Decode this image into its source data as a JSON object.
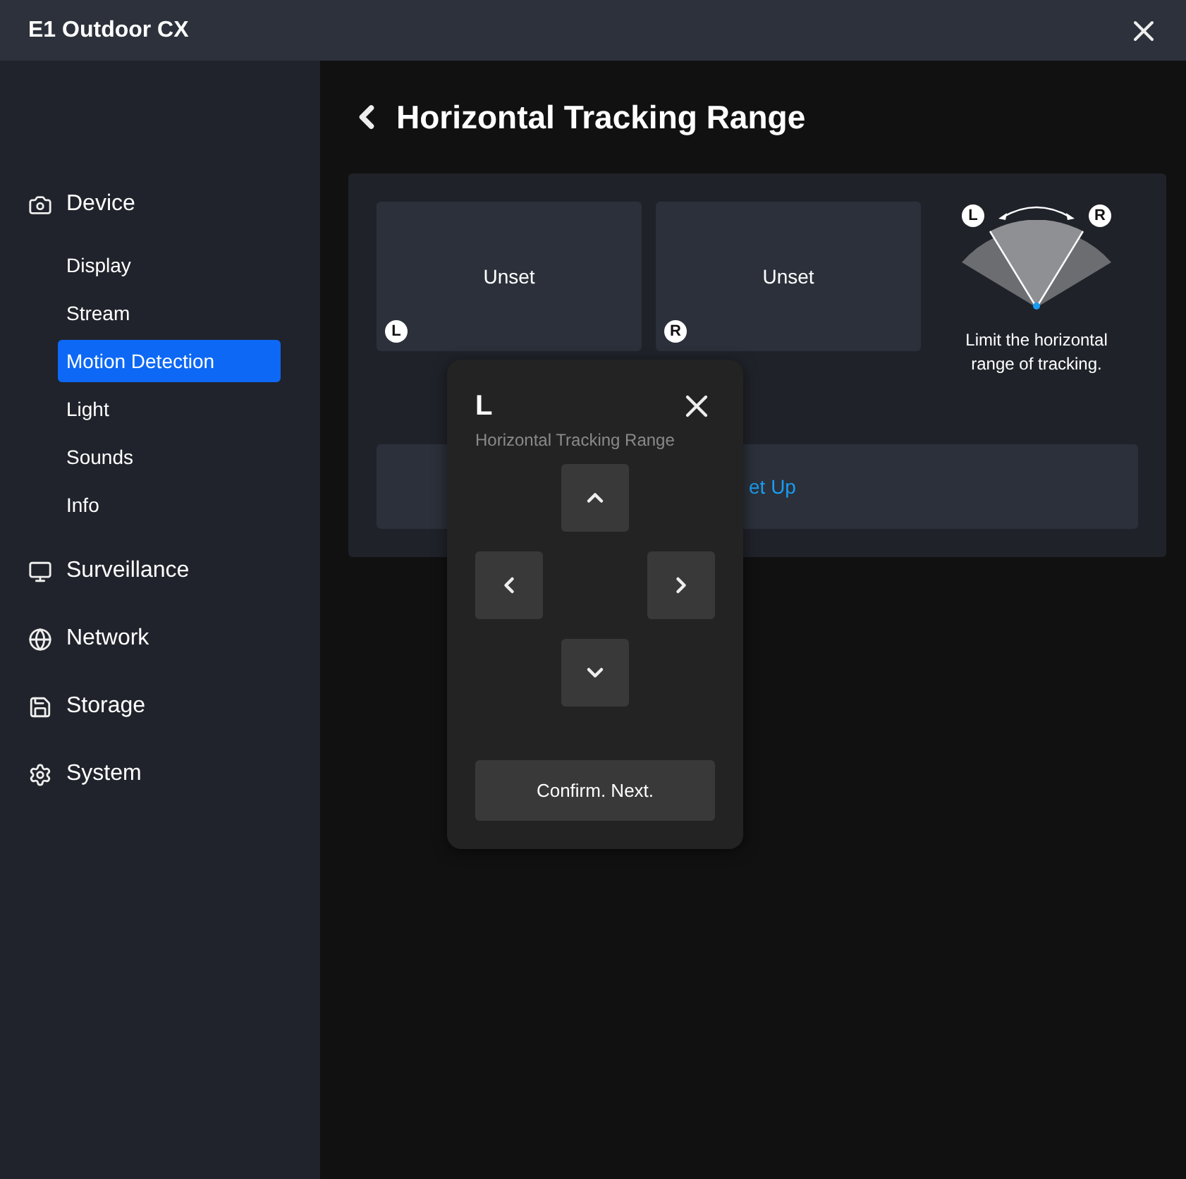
{
  "window": {
    "title": "E1 Outdoor CX"
  },
  "sidebar": {
    "groups": [
      {
        "label": "Device",
        "children": [
          {
            "label": "Display",
            "selected": false
          },
          {
            "label": "Stream",
            "selected": false
          },
          {
            "label": "Motion Detection",
            "selected": true
          },
          {
            "label": "Light",
            "selected": false
          },
          {
            "label": "Sounds",
            "selected": false
          },
          {
            "label": "Info",
            "selected": false
          }
        ]
      },
      {
        "label": "Surveillance"
      },
      {
        "label": "Network"
      },
      {
        "label": "Storage"
      },
      {
        "label": "System"
      }
    ]
  },
  "page": {
    "title": "Horizontal Tracking Range"
  },
  "tiles": [
    {
      "label": "Unset",
      "marker": "L"
    },
    {
      "label": "Unset",
      "marker": "R"
    }
  ],
  "diagram": {
    "left": "L",
    "right": "R",
    "caption": "Limit the horizontal range of tracking."
  },
  "setup_button": "et Up",
  "popup": {
    "title": "L",
    "subtitle": "Horizontal Tracking Range",
    "confirm": "Confirm. Next."
  }
}
